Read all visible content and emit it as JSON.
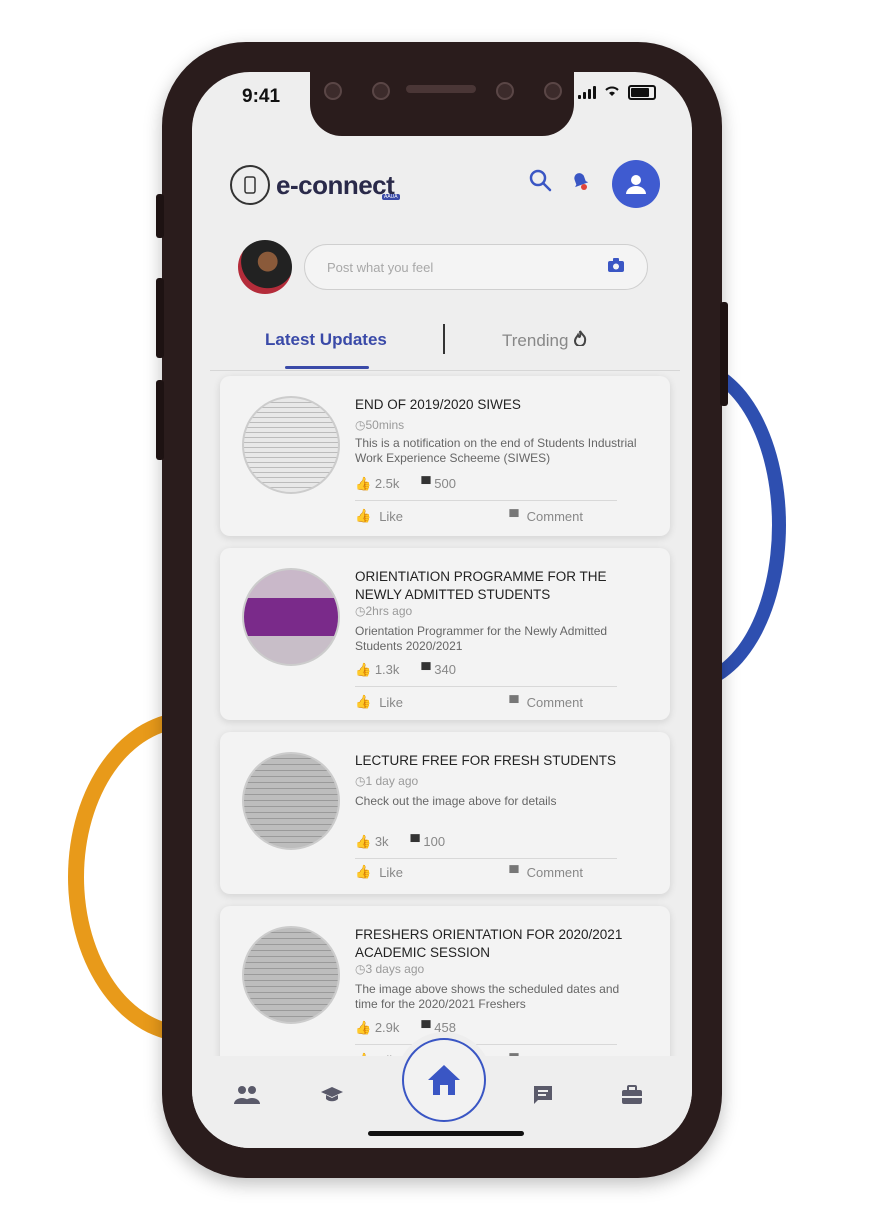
{
  "status": {
    "time": "9:41"
  },
  "header": {
    "logo_text": "e-connect",
    "logo_badge": "AAUA",
    "search_icon": "search-icon",
    "bell_icon": "bell-icon",
    "profile_icon": "profile-icon"
  },
  "composer": {
    "placeholder": "Post what you feel"
  },
  "tabs": [
    {
      "label": "Latest Updates"
    },
    {
      "label": "Trending"
    }
  ],
  "posts": [
    {
      "title": "END OF 2019/2020 SIWES",
      "time": "50mins",
      "desc": "This is a notification on the end of Students Industrial Work Experience Scheeme (SIWES)",
      "likes": "2.5k",
      "comments": "500"
    },
    {
      "title": "ORIENTIATION PROGRAMME FOR THE NEWLY ADMITTED STUDENTS",
      "time": "2hrs ago",
      "desc": "Orientation Programmer for the Newly Admitted Students 2020/2021",
      "likes": "1.3k",
      "comments": "340"
    },
    {
      "title": "LECTURE FREE FOR FRESH STUDENTS",
      "time": "1 day ago",
      "desc": "Check out the image above for details",
      "likes": "3k",
      "comments": "100"
    },
    {
      "title": "FRESHERS ORIENTATION FOR 2020/2021 ACADEMIC SESSION",
      "time": "3 days ago",
      "desc": "The image above shows the scheduled dates and time for the 2020/2021 Freshers",
      "likes": "2.9k",
      "comments": "458"
    }
  ],
  "actions": {
    "like": "Like",
    "comment": "Comment"
  },
  "colors": {
    "accent": "#3a4aa8",
    "ring_blue": "#2e4fb0",
    "ring_orange": "#e89a1a"
  }
}
